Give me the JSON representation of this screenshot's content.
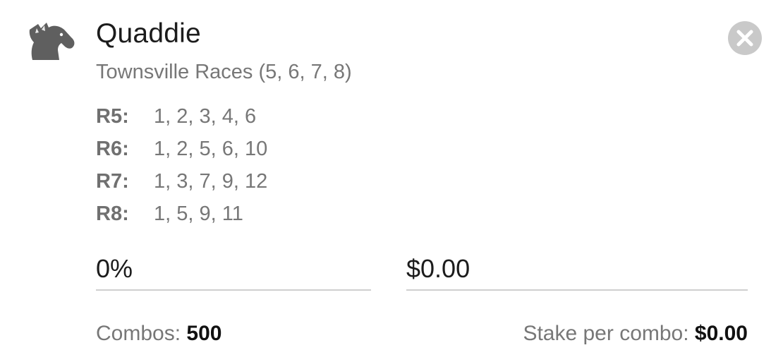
{
  "bet": {
    "icon": "horse-head-icon",
    "title": "Quaddie",
    "meeting": "Townsville Races (5, 6, 7, 8)",
    "close_icon": "close-icon"
  },
  "legs": [
    {
      "label": "R5:",
      "runners": "1, 2, 3, 4, 6"
    },
    {
      "label": "R6:",
      "runners": "1, 2, 5, 6, 10"
    },
    {
      "label": "R7:",
      "runners": "1, 3, 7, 9, 12"
    },
    {
      "label": "R8:",
      "runners": "1, 5, 9, 11"
    }
  ],
  "inputs": {
    "percentage": "0%",
    "amount": "$0.00"
  },
  "summary": {
    "combos_label": "Combos:",
    "combos_value": "500",
    "stake_label": "Stake per combo:",
    "stake_value": "$0.00"
  },
  "colors": {
    "icon": "#5f5f5f",
    "close_bg": "#c9c9c9",
    "muted_text": "#777777",
    "underline": "#cfcfcf"
  }
}
